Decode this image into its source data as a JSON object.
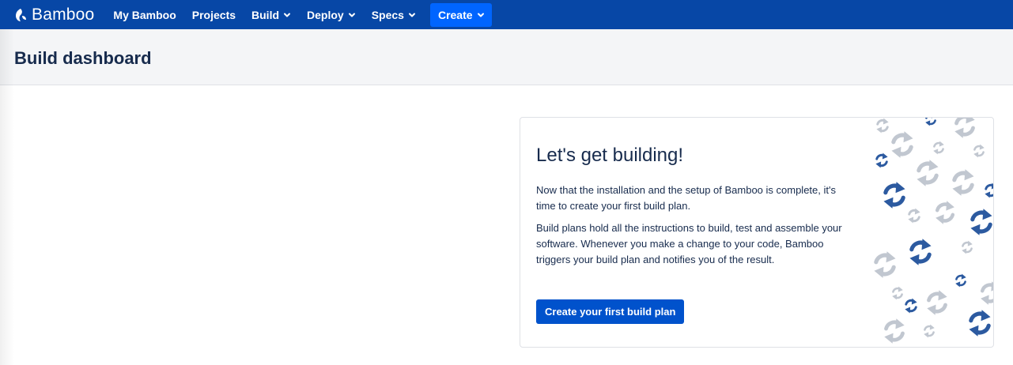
{
  "topbar": {
    "logo_text": "Bamboo",
    "nav": [
      {
        "label": "My Bamboo",
        "dropdown": false
      },
      {
        "label": "Projects",
        "dropdown": false
      },
      {
        "label": "Build",
        "dropdown": true
      },
      {
        "label": "Deploy",
        "dropdown": true
      },
      {
        "label": "Specs",
        "dropdown": true
      }
    ],
    "create_label": "Create"
  },
  "header": {
    "title": "Build dashboard"
  },
  "card": {
    "heading": "Let's get building!",
    "paragraph1": "Now that the installation and the setup of Bamboo is complete, it's time to create your first build plan.",
    "paragraph2": "Build plans hold all the instructions to build, test and assemble your software. Whenever you make a change to your code, Bamboo triggers your build plan and notifies you of the result.",
    "cta_label": "Create your first build plan"
  },
  "colors": {
    "topbar": "#0747a6",
    "create_button": "#0065ff",
    "primary_button": "#0052cc",
    "header_bg": "#f4f5f7",
    "text": "#172b4d",
    "icon_blue": "#2c5aa0",
    "icon_gray": "#c1c7d0"
  },
  "icons": {
    "logo": "bamboo-logo-icon",
    "dropdown": "chevron-down-icon",
    "decor": "build-refresh-icon"
  }
}
